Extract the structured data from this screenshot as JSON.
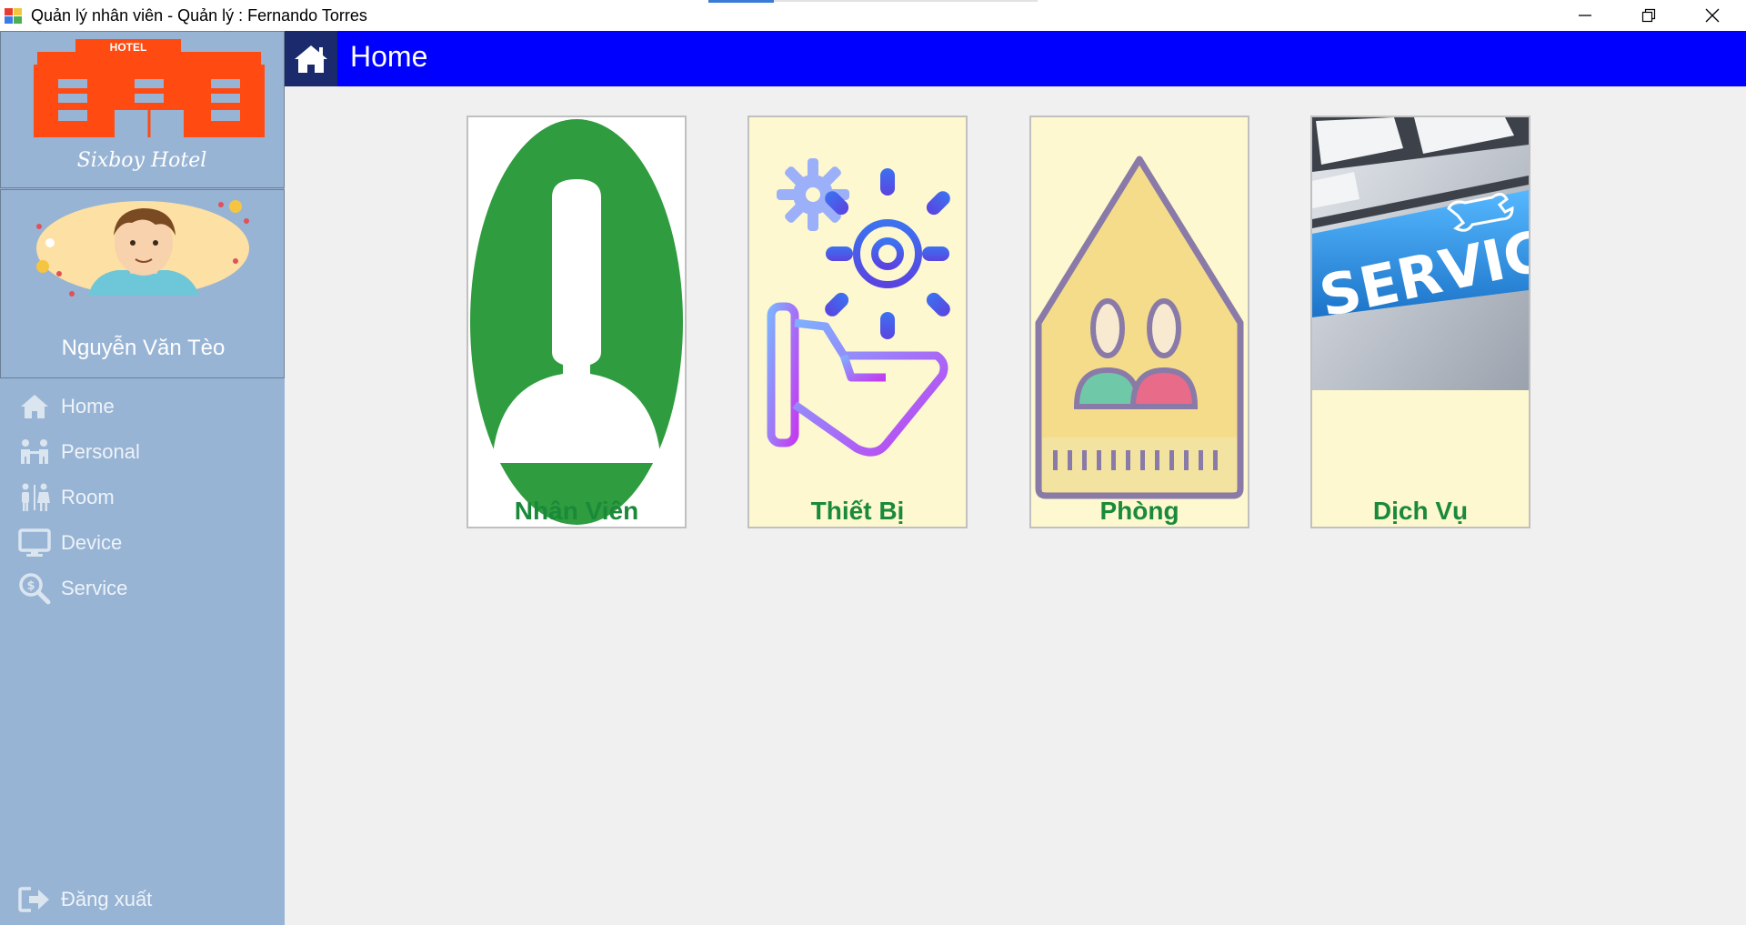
{
  "window": {
    "title": "Quản lý nhân viên - Quản lý : Fernando Torres",
    "minimize_label": "minimize",
    "restore_label": "restore",
    "close_label": "close"
  },
  "sidebar": {
    "logo": {
      "hotel_text": "HOTEL",
      "brand_text": "Sixboy Hotel"
    },
    "user_name": "Nguyễn Văn Tèo",
    "items": [
      {
        "label": "Home",
        "icon": "home-icon"
      },
      {
        "label": "Personal",
        "icon": "people-icon"
      },
      {
        "label": "Room",
        "icon": "restroom-icon"
      },
      {
        "label": "Device",
        "icon": "monitor-icon"
      },
      {
        "label": "Service",
        "icon": "search-dollar-icon"
      }
    ],
    "logout_label": "Đăng xuất"
  },
  "header": {
    "title": "Home",
    "color": "#0000ff"
  },
  "tiles": [
    {
      "label": "Nhân Viên",
      "icon": "employee-icon"
    },
    {
      "label": "Thiết Bị",
      "icon": "device-gear-hand-icon"
    },
    {
      "label": "Phòng",
      "icon": "room-house-icon"
    },
    {
      "label": "Dịch Vụ",
      "icon": "service-keyboard-icon",
      "key_text": "SERVICE"
    }
  ],
  "colors": {
    "sidebar_bg": "#98b4d4",
    "tile_label": "#1a8a3a",
    "tile_bg": "#fdf8d0"
  }
}
